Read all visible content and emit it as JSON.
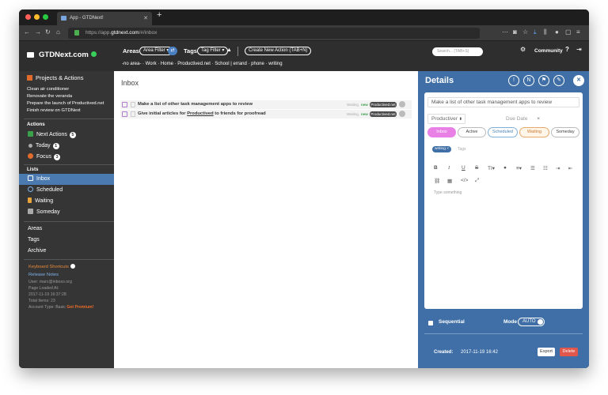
{
  "browser": {
    "tab_title": "App - GTDNext!",
    "new_tab": "+",
    "tab_close": "✕",
    "url_prefix": "https://app.",
    "url_host": "gtdnext.com",
    "url_path": "/#/inbox"
  },
  "brand": {
    "name": "GTDNext.com"
  },
  "header": {
    "areas_label": "Areas",
    "area_filter": "Area Filter ▾",
    "tags_label": "Tags",
    "tag_filter": "Tag Filter ▾",
    "create_action": "Create New Action (TAB+N)",
    "tag_links": "-no area-  ·  Work  ·  Home  ·  Productived.net  ·  School   |   errand  ·  phone  ·  writing",
    "search_placeholder": "Search... (TAB+S)",
    "community": "Community"
  },
  "sidebar": {
    "projects_heading": "Projects & Actions",
    "projects": [
      "Clean air conditioner",
      "Renovate the veranda",
      "Prepare the launch of Productived.net",
      "Finish review on GTDNext"
    ],
    "actions_heading": "Actions",
    "next_actions": {
      "label": "Next Actions",
      "count": "5"
    },
    "today": {
      "label": "Today",
      "count": "1"
    },
    "focus": {
      "label": "Focus",
      "count": "3"
    },
    "lists_heading": "Lists",
    "lists": [
      "Inbox",
      "Scheduled",
      "Waiting",
      "Someday"
    ],
    "areas": "Areas",
    "tags": "Tags",
    "archive": "Archive",
    "keyboard_shortcuts": "Keyboard Shortcuts",
    "release_notes": "Release Notes",
    "user": "User: marc@inboxo.org",
    "page_loaded": "Page Loaded At:",
    "page_loaded_val": "2017-11-19 16:37:28",
    "total_items": "Total Items: 23",
    "account_type": "Account Type: Basic",
    "get_premium": "Get Premium!"
  },
  "inbox": {
    "title": "Inbox",
    "rows": [
      {
        "text_pre": "Make a list of other task management apps to review",
        "text_u": "",
        "text_post": "",
        "waiting": "Waiting",
        "new": "new",
        "tag": "Productived.net"
      },
      {
        "text_pre": "Give initial articles for ",
        "text_u": "Productived",
        "text_post": " to friends for proofread",
        "waiting": "Waiting",
        "new": "new",
        "tag": "Productived.net"
      }
    ]
  },
  "details": {
    "title": "Details",
    "task_name": "Make a list of other task management apps to review",
    "area": "Productiver",
    "due_placeholder": "Due Date",
    "statuses": [
      "Inbox",
      "Active",
      "Scheduled",
      "Waiting",
      "Someday"
    ],
    "tag_chip": "writing ×",
    "tags_placeholder": "Tags",
    "editor_placeholder": "Type something",
    "sequential": "Sequential",
    "mode_label": "Mode",
    "mode_value": "AUTO",
    "created_label": "Created:",
    "created_value": "2017-11-19 16:42",
    "export": "Export",
    "delete": "Delete"
  }
}
